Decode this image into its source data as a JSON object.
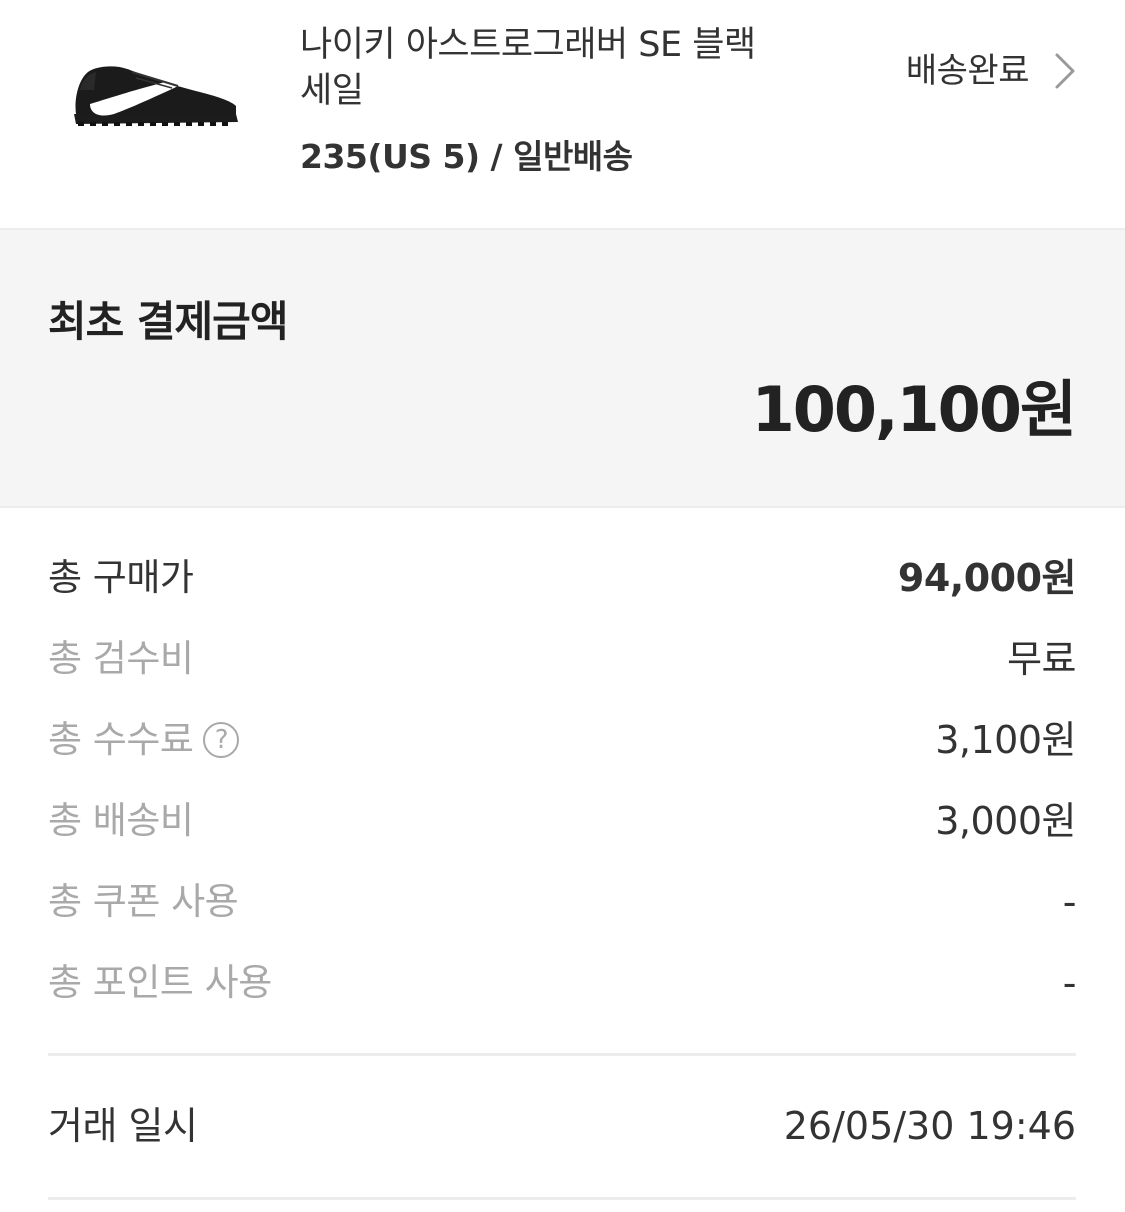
{
  "product": {
    "name": "나이키 아스트로그래버 SE 블랙 세일",
    "option": "235(US 5) / 일반배송",
    "status": "배송완료",
    "image_icon": "sneaker-image"
  },
  "initial_payment": {
    "label": "최초 결제금액",
    "amount": "100,100원"
  },
  "breakdown": [
    {
      "label": "총 구매가",
      "value": "94,000원"
    },
    {
      "label": "총 검수비",
      "value": "무료"
    },
    {
      "label": "총 수수료",
      "value": "3,100원",
      "help_icon": "?"
    },
    {
      "label": "총 배송비",
      "value": "3,000원"
    },
    {
      "label": "총 쿠폰 사용",
      "value": "-"
    },
    {
      "label": "총 포인트 사용",
      "value": "-"
    }
  ],
  "trade": {
    "label": "거래 일시",
    "datetime": "26/05/30 19:46"
  },
  "colors": {
    "text_primary": "#333333",
    "text_muted": "#a9a9a9",
    "panel_bg": "#f5f5f5",
    "divider": "#ececec"
  }
}
